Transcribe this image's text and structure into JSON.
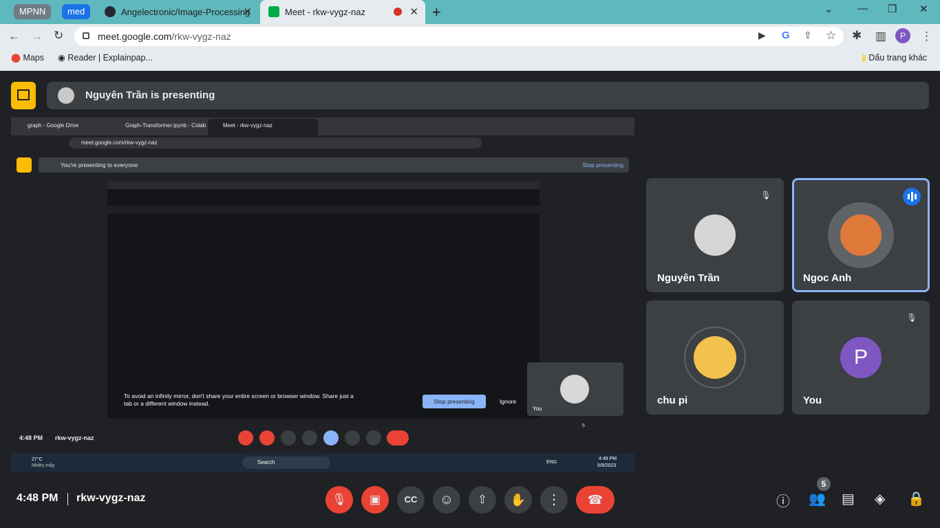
{
  "tabs": {
    "group1": "MPNN",
    "group2": "med",
    "tab1": "Angelectronic/Image-Processing",
    "tab2": "Meet - rkw-vygz-naz"
  },
  "address": {
    "url_host": "meet.google.com",
    "url_path": "/rkw-vygz-naz"
  },
  "bookmarks": {
    "b1": "Maps",
    "b2": "Reader | Explainpap...",
    "other": "Dấu trang khác"
  },
  "profile": {
    "initial": "P"
  },
  "banner": {
    "text": "Nguyên Trần is presenting"
  },
  "shared": {
    "tab1": "graph - Google Drive",
    "tab2": "Graph-Transformer.ipynb - Colab",
    "tab3": "Meet - rkw-vygz-naz",
    "url": "meet.google.com/rkw-vygz-naz",
    "presenting": "You're presenting to everyone",
    "stop": "Stop presenting",
    "mirror_warn": "To avoid an infinity mirror, don't share your entire screen or browser window. Share just a tab or a different window instead.",
    "ignore": "Ignore",
    "you": "You",
    "time": "4:48 PM",
    "meeting": "rkw-vygz-naz",
    "count": "5",
    "weather_temp": "27°C",
    "weather_desc": "Nhiều mây",
    "search": "Search",
    "lang": "ENG",
    "tb_time": "4:48 PM",
    "tb_date": "5/9/2023"
  },
  "participants": [
    {
      "name": "Nguyên Trần"
    },
    {
      "name": "Ngoc Anh"
    },
    {
      "name": "chu pi"
    },
    {
      "name": "You",
      "initial": "P"
    }
  ],
  "bottom": {
    "time": "4:48 PM",
    "meeting": "rkw-vygz-naz",
    "people_count": "5"
  },
  "colors": {
    "accent": "#8ab4f8",
    "red": "#ea4335",
    "yellow": "#fbbc04",
    "tabstrip": "#5fb8bd"
  }
}
